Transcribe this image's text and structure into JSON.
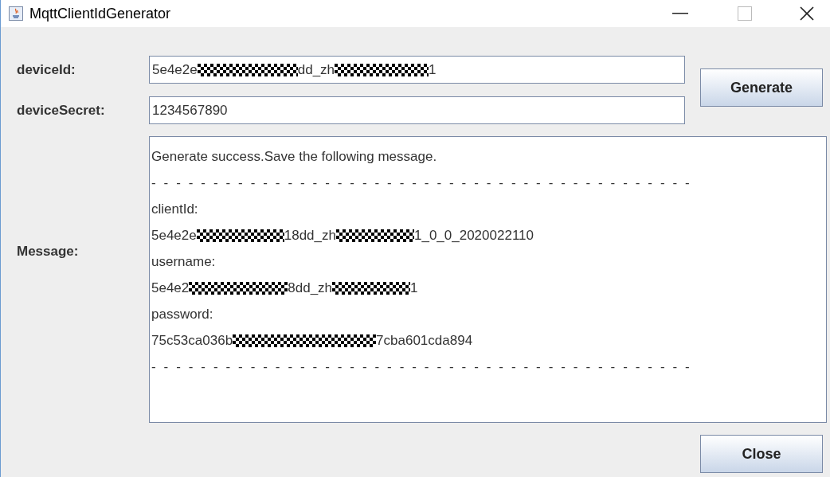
{
  "window": {
    "title": "MqttClientIdGenerator"
  },
  "fields": [
    {
      "label": "deviceId:",
      "value": [
        {
          "kind": "text",
          "text": "5e4e2e"
        },
        {
          "kind": "redacted"
        },
        {
          "kind": "text",
          "text": "dd_zh"
        },
        {
          "kind": "redacted"
        },
        {
          "kind": "text",
          "text": "1"
        }
      ]
    },
    {
      "label": "deviceSecret:",
      "value": [
        {
          "kind": "text",
          "text": "1234567890"
        }
      ]
    }
  ],
  "generate_button": "Generate",
  "message": {
    "label": "Message:",
    "lines": [
      {
        "kind": "text",
        "segments": [
          {
            "kind": "text",
            "text": "Generate success.Save the following message."
          }
        ]
      },
      {
        "kind": "separator",
        "segments": [
          {
            "kind": "text",
            "text": "- - - - - - - - - - - - - - - - - - - - - - - - - - - - - - - - - - - - - - - - - - - -"
          }
        ]
      },
      {
        "kind": "text",
        "segments": [
          {
            "kind": "text",
            "text": "clientId:"
          }
        ]
      },
      {
        "kind": "text",
        "segments": [
          {
            "kind": "text",
            "text": "5e4e2e"
          },
          {
            "kind": "redacted"
          },
          {
            "kind": "text",
            "text": "18dd_zh"
          },
          {
            "kind": "redacted"
          },
          {
            "kind": "text",
            "text": "1_0_0_2020022110"
          }
        ]
      },
      {
        "kind": "text",
        "segments": [
          {
            "kind": "text",
            "text": "username:"
          }
        ]
      },
      {
        "kind": "text",
        "segments": [
          {
            "kind": "text",
            "text": "5e4e2"
          },
          {
            "kind": "redacted"
          },
          {
            "kind": "text",
            "text": "8dd_zh"
          },
          {
            "kind": "redacted"
          },
          {
            "kind": "text",
            "text": "1"
          }
        ]
      },
      {
        "kind": "text",
        "segments": [
          {
            "kind": "text",
            "text": "password:"
          }
        ]
      },
      {
        "kind": "text",
        "segments": [
          {
            "kind": "text",
            "text": "75c53ca036b"
          },
          {
            "kind": "redacted"
          },
          {
            "kind": "text",
            "text": "7cba601cda894"
          }
        ]
      },
      {
        "kind": "separator",
        "segments": [
          {
            "kind": "text",
            "text": "- - - - - - - - - - - - - - - - - - - - - - - - - - - - - - - - - - - - - - - - - - - -"
          }
        ]
      }
    ]
  },
  "close_button": "Close"
}
